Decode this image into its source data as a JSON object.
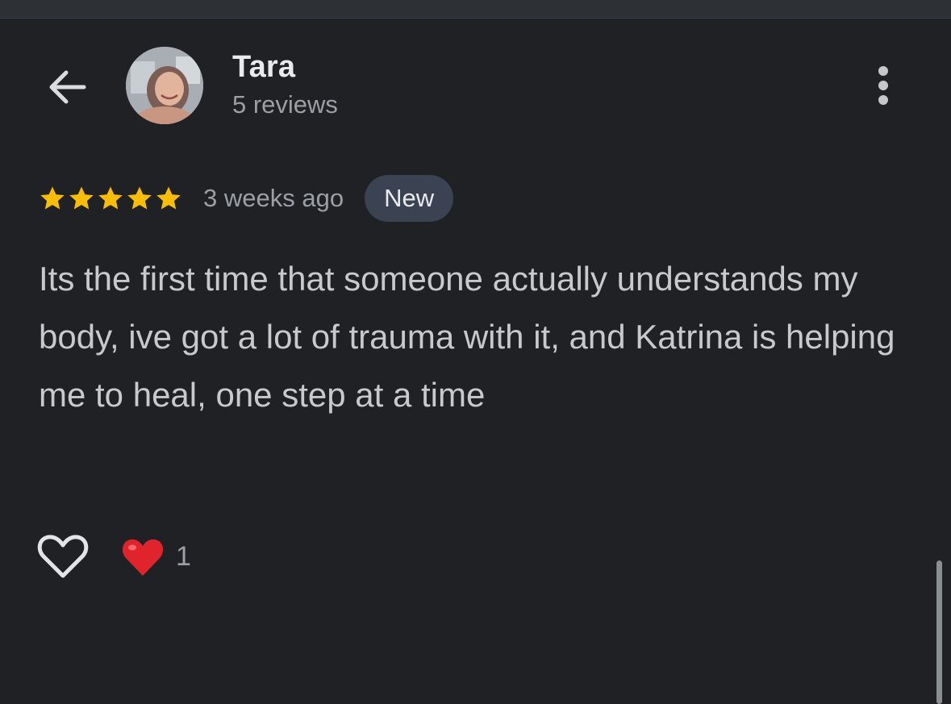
{
  "header": {
    "back_icon": "arrow-left-icon",
    "reviewer_name": "Tara",
    "review_count": "5 reviews",
    "more_icon": "more-vertical-icon"
  },
  "review": {
    "rating": 5,
    "rating_max": 5,
    "star_color": "#fbbc04",
    "time_ago": "3 weeks ago",
    "badge": "New",
    "text": "Its the first time that someone actually understands my body, ive got a lot of trauma with it, and Katrina is helping me to heal, one step at a time"
  },
  "reactions": {
    "like_icon": "heart-outline-icon",
    "reaction_icon": "red-heart-icon",
    "reaction_count": "1"
  },
  "colors": {
    "background": "#202124",
    "text_primary": "#e8eaed",
    "text_secondary": "#9aa0a6",
    "badge_bg": "#3b4251",
    "heart_red": "#e0242b"
  }
}
